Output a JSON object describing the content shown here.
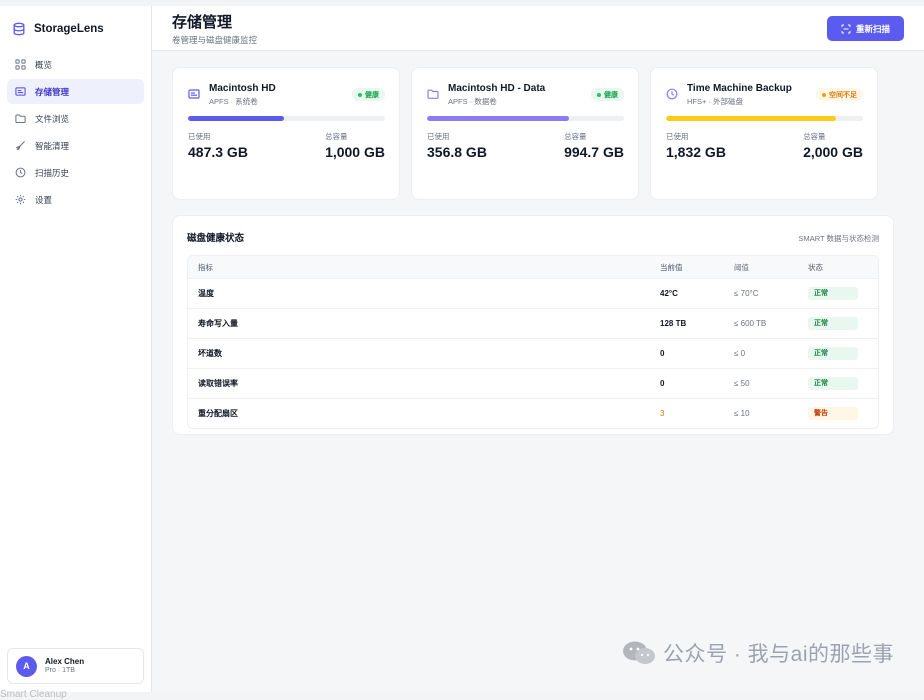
{
  "brand": {
    "name": "StorageLens",
    "icon": "database-icon"
  },
  "nav": [
    {
      "label": "概览",
      "icon": "grid-icon",
      "active": false
    },
    {
      "label": "存储管理",
      "icon": "drive-icon",
      "active": true
    },
    {
      "label": "文件浏览",
      "icon": "folder-icon",
      "active": false
    },
    {
      "label": "智能清理",
      "icon": "broom-icon",
      "active": false
    },
    {
      "label": "扫描历史",
      "icon": "clock-icon",
      "active": false
    },
    {
      "label": "设置",
      "icon": "gear-icon",
      "active": false
    }
  ],
  "user": {
    "initial": "A",
    "name": "Alex Chen",
    "plan": "Pro · 1TB"
  },
  "header": {
    "title": "存储管理",
    "subtitle": "卷管理与磁盘健康监控",
    "rescan_label": "重新扫描"
  },
  "colors": {
    "accent": "#5b5bf0",
    "ok": "#22c55e",
    "warn": "#f59e0b",
    "bar_yellow": "#facc15"
  },
  "volumes": [
    {
      "name": "Macintosh HD",
      "meta": "APFS · 系统卷",
      "icon": "drive-icon",
      "badge": "健康",
      "status": "ok",
      "used_label": "已使用",
      "used": "487.3 GB",
      "total_label": "总容量",
      "total": "1,000 GB",
      "fill_fraction": 0.487,
      "bar_color": "#5b5bf0"
    },
    {
      "name": "Macintosh HD - Data",
      "meta": "APFS · 数据卷",
      "icon": "folder-icon",
      "badge": "健康",
      "status": "ok",
      "used_label": "已使用",
      "used": "356.8 GB",
      "total_label": "总容量",
      "total": "994.7 GB",
      "fill_fraction": 0.72,
      "bar_color": "#8b7cf6"
    },
    {
      "name": "Time Machine Backup",
      "meta": "HFS+ · 外部磁盘",
      "icon": "clock-icon",
      "badge": "空间不足",
      "status": "warn",
      "used_label": "已使用",
      "used": "1,832 GB",
      "total_label": "总容量",
      "total": "2,000 GB",
      "fill_fraction": 0.865,
      "bar_color": "#facc15"
    }
  ],
  "health": {
    "title": "磁盘健康状态",
    "description": "SMART 数据与状态检测",
    "columns": [
      "指标",
      "当前值",
      "阈值",
      "状态"
    ],
    "rows": [
      {
        "metric": "温度",
        "value": "42°C",
        "threshold": "≤ 70°C",
        "status": "正常",
        "level": "ok"
      },
      {
        "metric": "寿命写入量",
        "value": "128 TB",
        "threshold": "≤ 600 TB",
        "status": "正常",
        "level": "ok"
      },
      {
        "metric": "坏道数",
        "value": "0",
        "threshold": "≤ 0",
        "status": "正常",
        "level": "ok"
      },
      {
        "metric": "读取错误率",
        "value": "0",
        "threshold": "≤ 50",
        "status": "正常",
        "level": "ok"
      },
      {
        "metric": "重分配扇区",
        "value": "3",
        "threshold": "≤ 10",
        "status": "警告",
        "level": "warn"
      }
    ]
  },
  "watermark": {
    "text": "公众号 · 我与ai的那些事",
    "icon": "wechat-icon"
  },
  "caption": {
    "bottom": "Smart Cleanup"
  }
}
